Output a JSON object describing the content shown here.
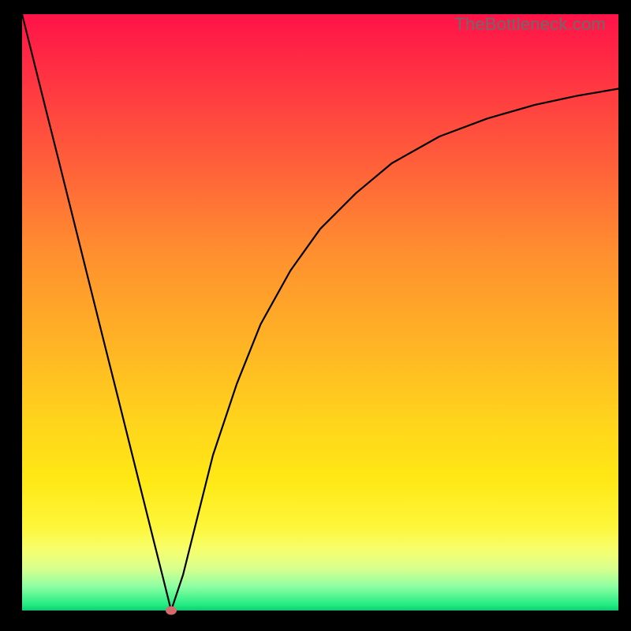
{
  "watermark": "TheBottleneck.com",
  "chart_data": {
    "type": "line",
    "title": "",
    "xlabel": "",
    "ylabel": "",
    "xlim": [
      0,
      100
    ],
    "ylim": [
      0,
      100
    ],
    "grid": false,
    "legend": false,
    "series": [
      {
        "name": "bottleneck-curve",
        "x": [
          0,
          2,
          4,
          6,
          8,
          10,
          12,
          14,
          16,
          18,
          20,
          22,
          23.5,
          25,
          27,
          29,
          32,
          36,
          40,
          45,
          50,
          56,
          62,
          70,
          78,
          86,
          93,
          100
        ],
        "values": [
          100,
          92,
          84,
          76,
          68,
          60,
          52,
          44,
          36,
          28,
          20,
          12,
          6,
          0,
          6,
          14,
          26,
          38,
          48,
          57,
          64,
          70,
          75,
          79.5,
          82.5,
          84.8,
          86.3,
          87.5
        ]
      }
    ],
    "marker": {
      "x": 25,
      "y": 0,
      "color": "#d46a6c"
    },
    "background_gradient": {
      "top": "#ff1348",
      "mid": "#ffd31c",
      "bottom": "#0ccf70"
    }
  }
}
